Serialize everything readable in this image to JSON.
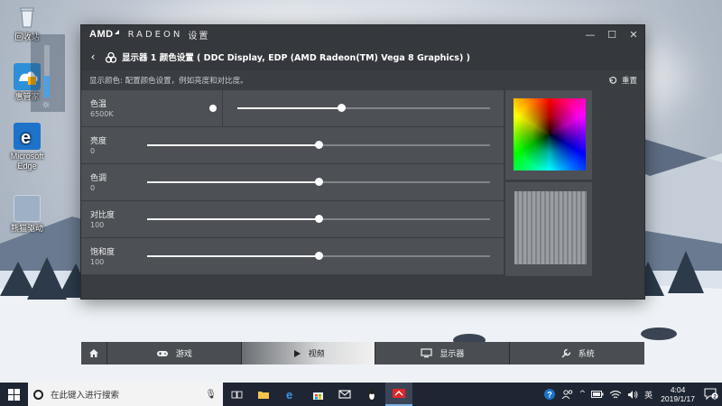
{
  "desktop": {
    "icons": [
      {
        "label": "回收站"
      },
      {
        "label": "惠管家"
      },
      {
        "label": "Microsoft Edge"
      },
      {
        "label": "熊猫驱动"
      }
    ]
  },
  "window": {
    "brand": "AMD",
    "product": "RADEON",
    "settings_label": "设置",
    "controls": {
      "minimize": "—",
      "maximize": "☐",
      "close": "✕"
    },
    "header_title": "显示器 1 颜色设置 ( DDC Display, EDP (AMD Radeon(TM) Vega 8 Graphics) )",
    "subtitle": "显示颜色:   配置颜色设置，例如亮度和对比度。",
    "reset_label": "重置",
    "settings": [
      {
        "label": "色温",
        "value": "6500K",
        "level": 0.41
      },
      {
        "label": "亮度",
        "value": "0",
        "level": 0.5
      },
      {
        "label": "色调",
        "value": "0",
        "level": 0.5
      },
      {
        "label": "对比度",
        "value": "100",
        "level": 0.5
      },
      {
        "label": "饱和度",
        "value": "100",
        "level": 0.5
      }
    ],
    "tabs": [
      {
        "label": "游戏",
        "icon": "gamepad-icon",
        "active": false
      },
      {
        "label": "视频",
        "icon": "play-icon",
        "active": true
      },
      {
        "label": "显示器",
        "icon": "monitor-icon",
        "active": false
      },
      {
        "label": "系统",
        "icon": "wrench-icon",
        "active": false
      }
    ]
  },
  "taskbar": {
    "search_placeholder": "在此键入进行搜索",
    "language": "英",
    "time": "4:04",
    "date": "2019/1/17",
    "notification_count": "2"
  },
  "colors": {
    "accent_blue": "#4aa2e6",
    "amd_red": "#e0272a",
    "window_bg": "#3a3d42",
    "row_bg": "#4d5156"
  }
}
